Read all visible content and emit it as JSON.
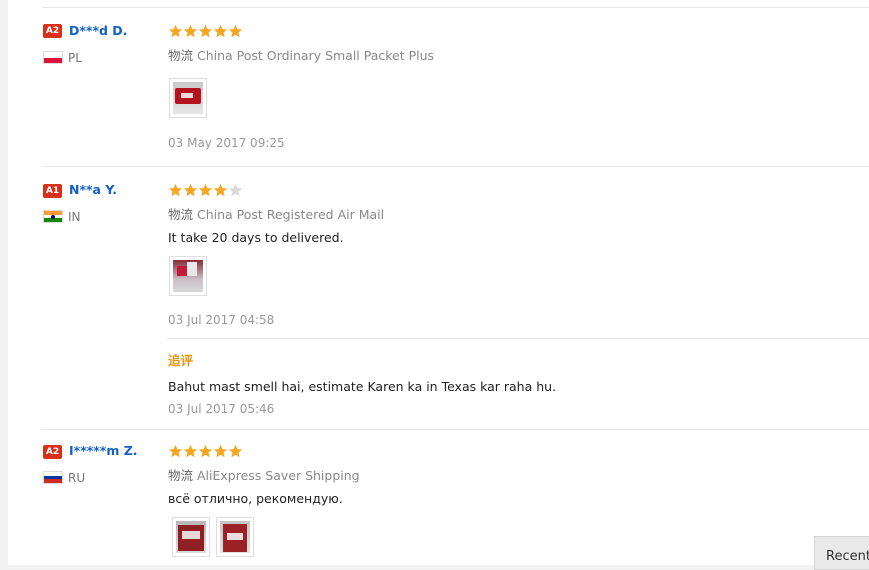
{
  "feedback": [
    {
      "level": "A2",
      "user": "D***d D.",
      "country": "PL",
      "flag": "pl-flag-icon",
      "rating": 5,
      "shipping_label": "物流",
      "shipping_method": "China Post Ordinary Small Packet Plus",
      "text": "",
      "photos": 1,
      "date": "03 May 2017 09:25"
    },
    {
      "level": "A1",
      "user": "N**a Y.",
      "country": "IN",
      "flag": "in-flag-icon",
      "rating": 4,
      "shipping_label": "物流",
      "shipping_method": "China Post Registered Air Mail",
      "text": "It take 20 days to delivered.",
      "photos": 1,
      "date": "03 Jul 2017 04:58",
      "additional": {
        "label": "追评",
        "text": "Bahut mast smell hai, estimate Karen ka in Texas kar raha hu.",
        "date": "03 Jul 2017 05:46"
      }
    },
    {
      "level": "A2",
      "user": "I*****m Z.",
      "country": "RU",
      "flag": "ru-flag-icon",
      "rating": 5,
      "shipping_label": "物流",
      "shipping_method": "AliExpress Saver Shipping",
      "text": "всё отлично, рекомендую.",
      "photos": 2,
      "date": ""
    }
  ],
  "recent_button": "Recent",
  "colors": {
    "star_filled": "#f5a623",
    "star_empty": "#d9d9d9",
    "username": "#1360c5",
    "badge": "#d9301a",
    "additional_label": "#e39712"
  }
}
